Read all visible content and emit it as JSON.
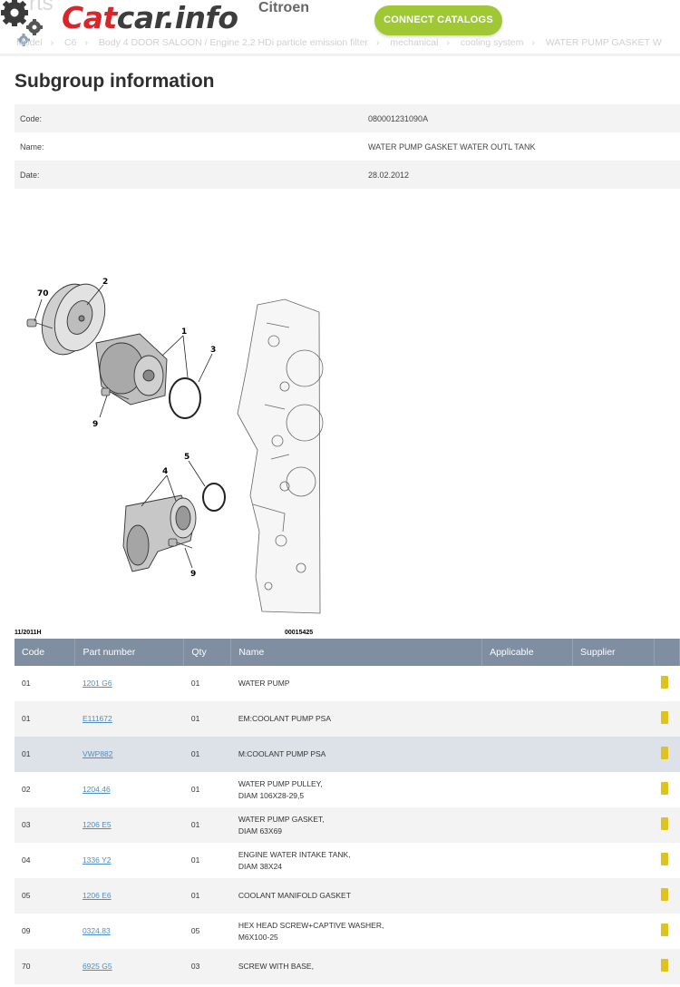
{
  "header": {
    "ghost_text": "rts",
    "logo_cat": "Cat",
    "logo_rest": "car.info",
    "brand": "Citroen",
    "connect_label": "CONNECT CATALOGS",
    "breadcrumb": [
      "Model",
      "C6",
      "Body 4 DOOR SALOON / Engine 2.2 HDi particle emission filter",
      "mechanical",
      "cooling system",
      "WATER PUMP GASKET W"
    ]
  },
  "subgroup": {
    "title": "Subgroup information",
    "rows": [
      {
        "label": "Code:",
        "value": "080001231090A"
      },
      {
        "label": "Name:",
        "value": "WATER PUMP GASKET WATER OUTL TANK"
      },
      {
        "label": "Date:",
        "value": "28.02.2012"
      }
    ]
  },
  "diagram": {
    "labels": [
      "70",
      "2",
      "1",
      "3",
      "9",
      "5",
      "4",
      "9"
    ],
    "footer_left": "11/2011H",
    "footer_right": "00015425"
  },
  "parts_table": {
    "columns": [
      "Code",
      "Part number",
      "Qty",
      "Name",
      "Applicable",
      "Supplier",
      ""
    ],
    "rows": [
      {
        "code": "01",
        "part": "1201 G6",
        "qty": "01",
        "name1": "WATER PUMP",
        "name2": "",
        "style": "odd"
      },
      {
        "code": "01",
        "part": "E111672",
        "qty": "01",
        "name1": "EM:COOLANT PUMP PSA",
        "name2": "",
        "style": "even"
      },
      {
        "code": "01",
        "part": "VWP882",
        "qty": "01",
        "name1": "M:COOLANT PUMP PSA",
        "name2": "",
        "style": "hl"
      },
      {
        "code": "02",
        "part": "1204.46",
        "qty": "01",
        "name1": "WATER PUMP PULLEY,",
        "name2": "DIAM 106X28-29,5",
        "style": "odd"
      },
      {
        "code": "03",
        "part": "1206 E5",
        "qty": "01",
        "name1": "WATER PUMP GASKET,",
        "name2": "DIAM 63X69",
        "style": "even"
      },
      {
        "code": "04",
        "part": "1336 Y2",
        "qty": "01",
        "name1": "ENGINE WATER INTAKE TANK,",
        "name2": "DIAM 38X24",
        "style": "odd"
      },
      {
        "code": "05",
        "part": "1206 E6",
        "qty": "01",
        "name1": "COOLANT MANIFOLD GASKET",
        "name2": "",
        "style": "even"
      },
      {
        "code": "09",
        "part": "0324.83",
        "qty": "05",
        "name1": "HEX HEAD SCREW+CAPTIVE WASHER,",
        "name2": "M6X100-25",
        "style": "odd"
      },
      {
        "code": "70",
        "part": "6925 G5",
        "qty": "03",
        "name1": "SCREW WITH BASE,",
        "name2": "",
        "style": "even"
      }
    ]
  },
  "colors": {
    "logo_red": "#d8262b",
    "button_green": "#9fc834",
    "table_header": "#7f8ea0",
    "link_blue": "#4a8fc8",
    "cart_yellow": "#e0c21c"
  }
}
